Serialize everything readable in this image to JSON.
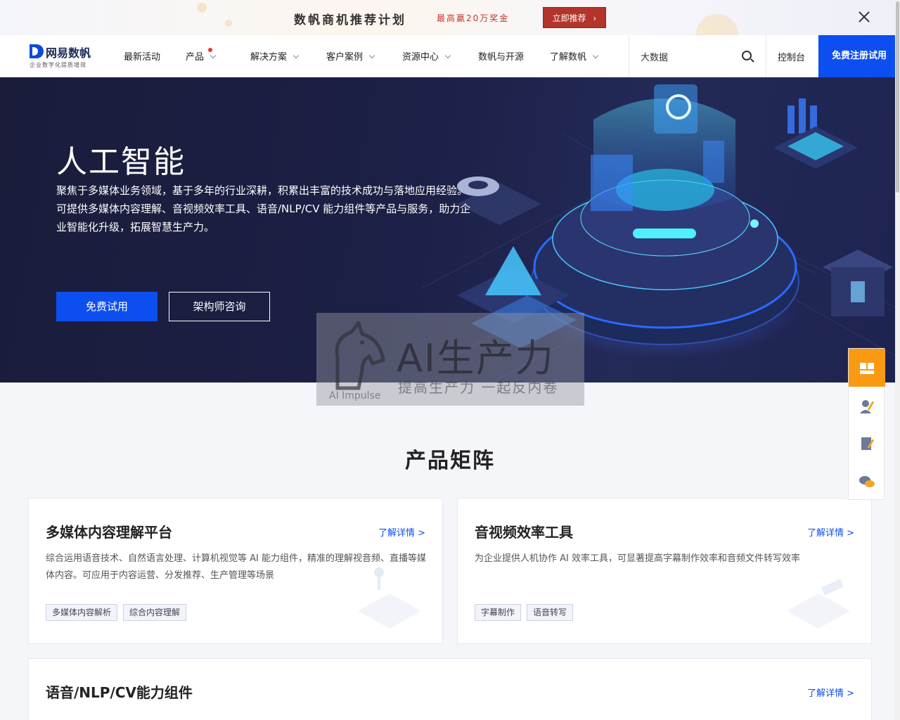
{
  "promo": {
    "title": "数帆商机推荐计划",
    "subtitle": "最高赢20万奖金",
    "button": "立即推荐"
  },
  "nav": {
    "logo_name": "网易数帆",
    "logo_slogan": "企业数字化提质增效",
    "items": [
      "最新活动",
      "产品",
      "解决方案",
      "客户案例",
      "资源中心",
      "数帆与开源",
      "了解数帆"
    ],
    "search_value": "大数据",
    "console": "控制台",
    "register": "免费注册试用"
  },
  "hero": {
    "title": "人工智能",
    "description": "聚焦于多媒体业务领域，基于多年的行业深耕，积累出丰富的技术成功与落地应用经验。可提供多媒体内容理解、音视频效率工具、语音/NLP/CV 能力组件等产品与服务，助力企业智能化升级，拓展智慧生产力。",
    "primary_button": "免费试用",
    "secondary_button": "架构师咨询"
  },
  "watermark": {
    "text": "AI生产力",
    "sub": "提高生产力 一起反内卷",
    "en": "AI Impulse"
  },
  "section": {
    "title": "产品矩阵",
    "cards": [
      {
        "title": "多媒体内容理解平台",
        "link": "了解详情 >",
        "desc": "综合运用语音技术、自然语言处理、计算机视觉等 AI 能力组件，精准的理解视音频、直播等媒体内容。可应用于内容运营、分发推荐、生产管理等场景",
        "tags": [
          "多媒体内容解析",
          "综合内容理解"
        ]
      },
      {
        "title": "音视频效率工具",
        "link": "了解详情 >",
        "desc": "为企业提供人机协作 AI 效率工具，可显著提高字幕制作效率和音频文件转写效率",
        "tags": [
          "字幕制作",
          "语音转写"
        ]
      },
      {
        "title": "语音/NLP/CV能力组件",
        "link": "了解详情 >",
        "desc": "",
        "tags": []
      }
    ]
  },
  "colors": {
    "brand_blue": "#0c4ef0",
    "promo_red": "#b3342a",
    "side_orange": "#f99a12",
    "hero_bg": "#1c2046"
  },
  "side_icons": [
    "grid-icon",
    "consultant-icon",
    "edit-icon",
    "chat-icon"
  ]
}
